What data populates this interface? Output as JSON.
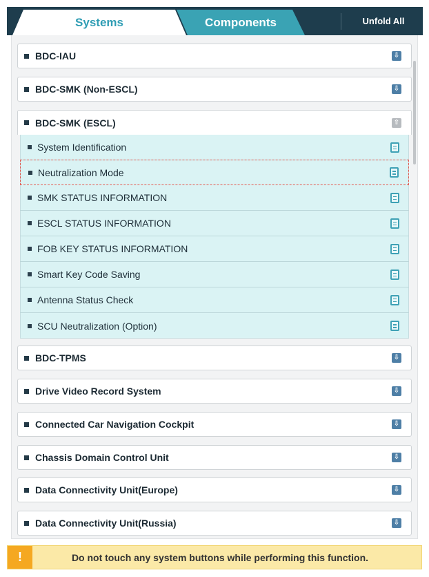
{
  "tabs": {
    "systems_label": "Systems",
    "components_label": "Components",
    "unfold_all_label": "Unfold All"
  },
  "systems": [
    {
      "label": "BDC-IAU",
      "state": "collapsed"
    },
    {
      "label": "BDC-SMK (Non-ESCL)",
      "state": "collapsed"
    },
    {
      "label": "BDC-SMK (ESCL)",
      "state": "expanded"
    },
    {
      "label": "BDC-TPMS",
      "state": "collapsed"
    },
    {
      "label": "Drive Video Record System",
      "state": "collapsed"
    },
    {
      "label": "Connected Car Navigation Cockpit",
      "state": "collapsed"
    },
    {
      "label": "Chassis Domain Control Unit",
      "state": "collapsed"
    },
    {
      "label": "Data Connectivity Unit(Europe)",
      "state": "collapsed"
    },
    {
      "label": "Data Connectivity Unit(Russia)",
      "state": "collapsed"
    }
  ],
  "functions": [
    {
      "label": "System Identification"
    },
    {
      "label": "Neutralization Mode",
      "selected": true
    },
    {
      "label": "SMK STATUS INFORMATION"
    },
    {
      "label": "ESCL STATUS INFORMATION"
    },
    {
      "label": "FOB KEY STATUS INFORMATION"
    },
    {
      "label": "Smart Key Code Saving"
    },
    {
      "label": "Antenna Status Check"
    },
    {
      "label": "SCU Neutralization (Option)"
    }
  ],
  "icons": {
    "fold_down": "⇩",
    "fold_up": "⇧",
    "warning": "!"
  },
  "warning": {
    "text": "Do not touch any system buttons while performing this function."
  },
  "colors": {
    "tabbar": "#1e3d4d",
    "tab_active_text": "#2f9db4",
    "tab_inactive_bg": "#3aa3b4",
    "submenu_bg": "#daf3f4",
    "selection_outline": "#e4574d",
    "warning_bg": "#fbe9a7",
    "warning_icon_bg": "#f5a821"
  }
}
